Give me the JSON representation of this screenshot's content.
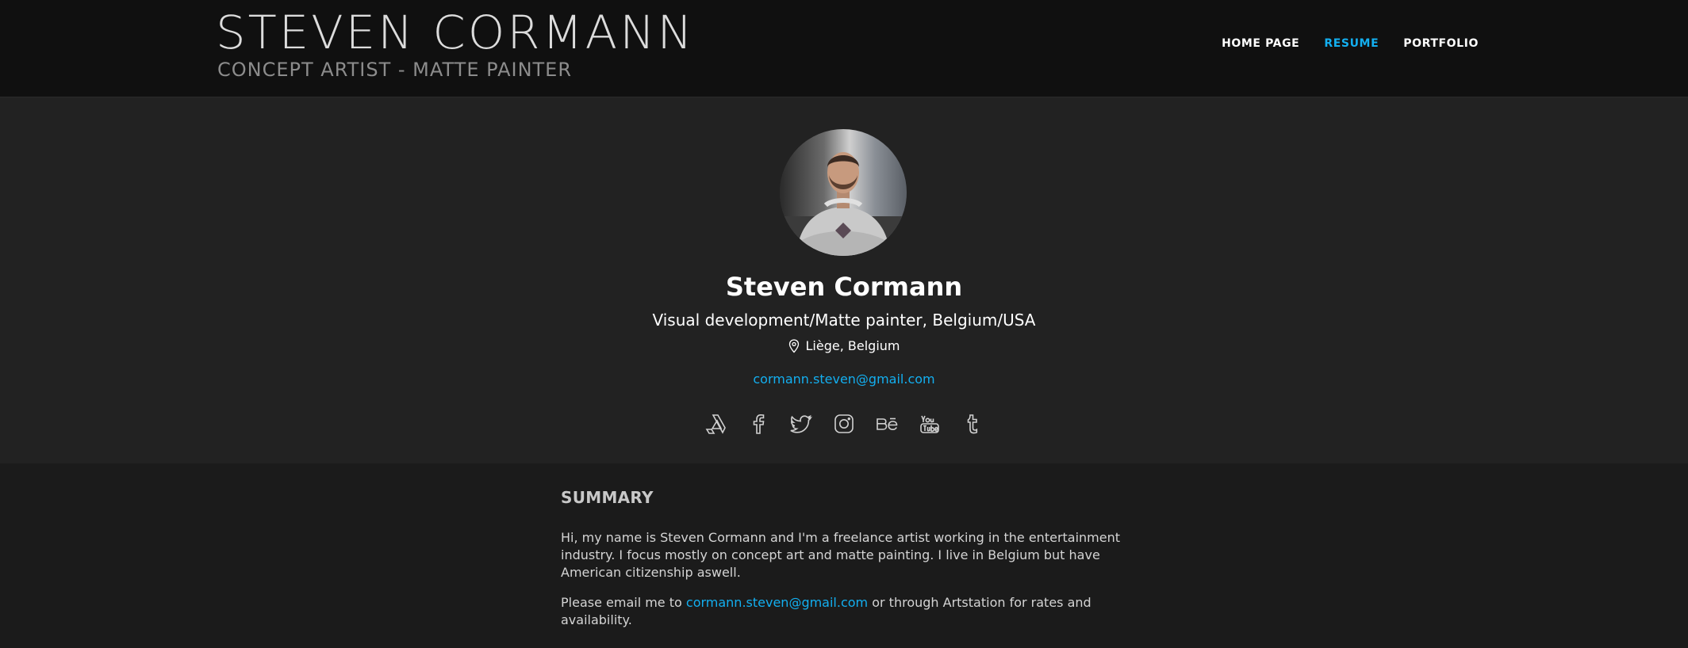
{
  "header": {
    "logo_title": "STEVEN CORMANN",
    "logo_subtitle": "CONCEPT ARTIST - MATTE PAINTER",
    "nav": [
      {
        "label": "HOME PAGE",
        "active": false
      },
      {
        "label": "RESUME",
        "active": true
      },
      {
        "label": "PORTFOLIO",
        "active": false
      }
    ]
  },
  "profile": {
    "name": "Steven Cormann",
    "headline": "Visual development/Matte painter, Belgium/USA",
    "location": "Liège, Belgium",
    "email": "cormann.steven@gmail.com",
    "socials": [
      "artstation-icon",
      "facebook-icon",
      "twitter-icon",
      "instagram-icon",
      "behance-icon",
      "youtube-icon",
      "tumblr-icon"
    ]
  },
  "summary": {
    "title": "SUMMARY",
    "paragraph1": "Hi, my name is Steven Cormann and I'm a freelance artist working in the entertainment industry. I focus mostly on concept art and matte painting. I live in Belgium but have American citizenship aswell.",
    "paragraph2_prefix": "Please email me to ",
    "paragraph2_link": "cormann.steven@gmail.com",
    "paragraph2_suffix": " or through Artstation for rates and availability."
  },
  "colors": {
    "accent": "#13aff0",
    "header_bg": "#101010",
    "profile_bg": "#222222",
    "body_bg": "#1b1b1b"
  }
}
